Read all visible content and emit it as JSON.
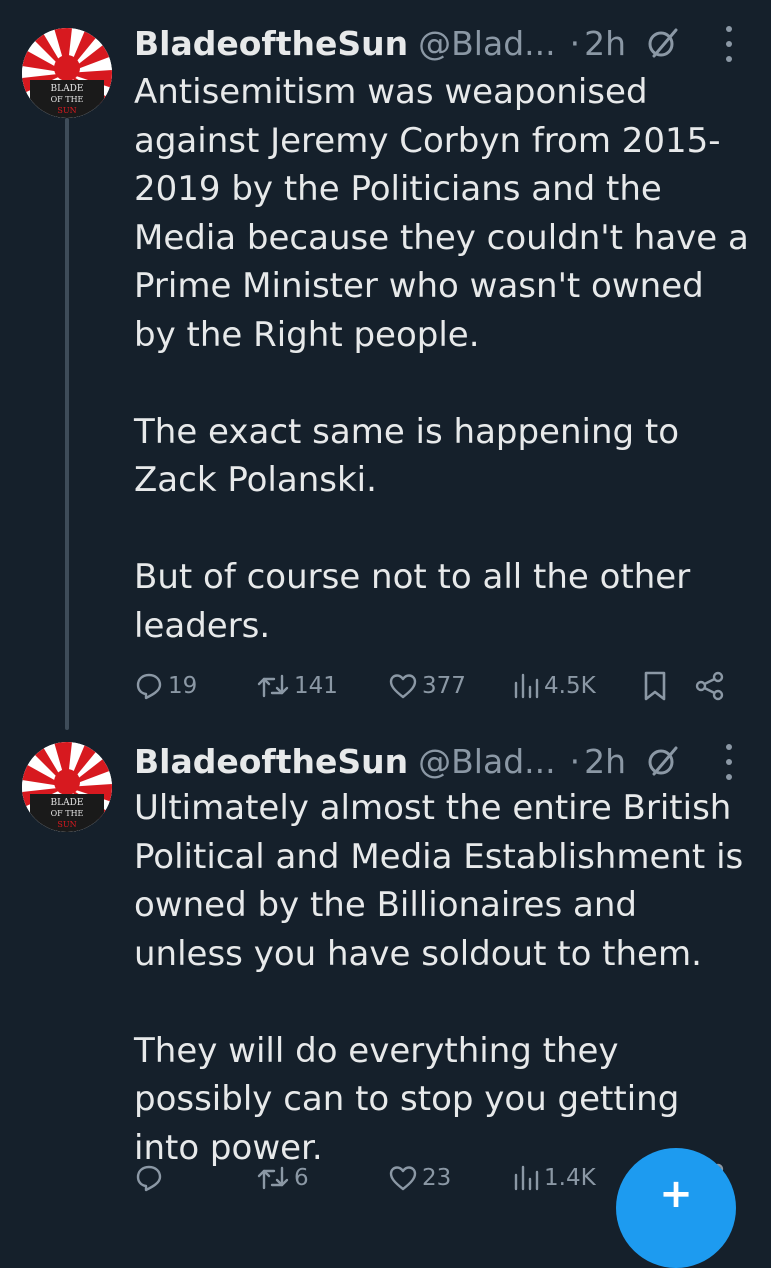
{
  "theme": {
    "background": "#15202b",
    "text": "#e7e9ea",
    "muted": "#8b98a5",
    "accent": "#1d9bf0",
    "avatar_red": "#d7191f"
  },
  "tweets": [
    {
      "author": {
        "display_name": "BladeoftheSun",
        "handle": "@Blad...",
        "avatar_text": [
          "BLADE",
          "OF THE",
          "SUN"
        ]
      },
      "separator": "·",
      "time": "2h",
      "text": "Antisemitism was weaponised against Jeremy Corbyn from 2015-2019 by the Politicians and the Media because they couldn't have a Prime Minister who wasn't owned by the Right people.\n\nThe exact same is happening to Zack Polanski.\n\nBut of course not to all the other leaders.",
      "stats": {
        "replies": "19",
        "reposts": "141",
        "likes": "377",
        "views": "4.5K"
      },
      "icons": [
        "grok-icon",
        "more-icon",
        "reply-icon",
        "retweet-icon",
        "like-icon",
        "views-icon",
        "bookmark-icon",
        "share-icon"
      ]
    },
    {
      "author": {
        "display_name": "BladeoftheSun",
        "handle": "@Blad...",
        "avatar_text": [
          "BLADE",
          "OF THE",
          "SUN"
        ]
      },
      "separator": "·",
      "time": "2h",
      "text": "Ultimately almost the entire British Political and Media Establishment is owned by the Billionaires and unless you have soldout to them.\n\nThey will do everything they possibly can to stop you getting into power.",
      "stats": {
        "replies": "",
        "reposts": "6",
        "likes": "23",
        "views": "1.4K"
      },
      "icons": [
        "grok-icon",
        "more-icon",
        "reply-icon",
        "retweet-icon",
        "like-icon",
        "views-icon",
        "bookmark-icon",
        "share-icon"
      ]
    }
  ],
  "compose_button": {
    "icon": "plus-icon",
    "label": "+"
  }
}
